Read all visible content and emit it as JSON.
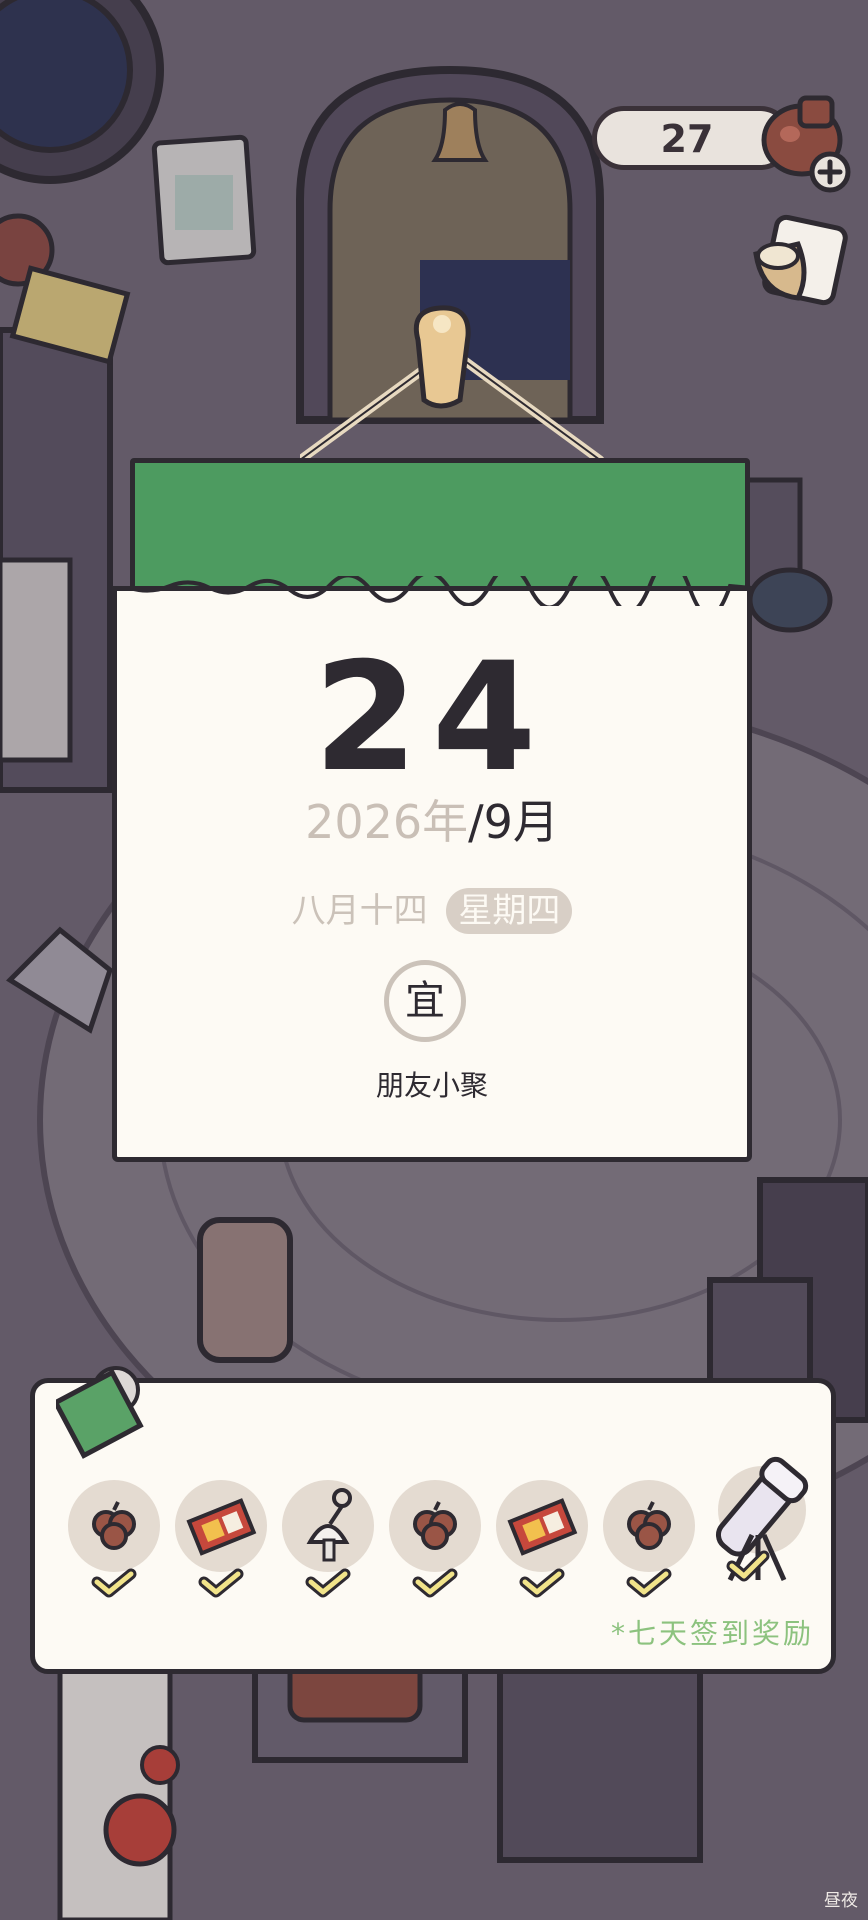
{
  "hud": {
    "coin_count": "27",
    "coin_icon": "clover-bag-icon",
    "add_icon": "plus-icon",
    "cup_icon": "bowl-icon"
  },
  "calendar": {
    "day": "24",
    "year": "2026年",
    "month": "/9月",
    "lunar_date": "八月十四",
    "weekday": "星期四",
    "suitable_label": "宜",
    "activity": "朋友小聚"
  },
  "rewards": {
    "items": [
      {
        "icon": "clover-icon",
        "claimed": true
      },
      {
        "icon": "ticket-icon",
        "claimed": true
      },
      {
        "icon": "wind-chime-icon",
        "claimed": true
      },
      {
        "icon": "clover-icon",
        "claimed": true
      },
      {
        "icon": "ticket-icon",
        "claimed": true
      },
      {
        "icon": "clover-icon",
        "claimed": true
      },
      {
        "icon": "telescope-icon",
        "claimed": true
      }
    ],
    "note": "*七天签到奖励"
  },
  "mode_label": "昼夜",
  "colors": {
    "calendar_green": "#4d9b60",
    "paper": "#fdfaf4",
    "outline": "#2e2a31",
    "note_green": "#8cc27e",
    "background": "#6b6270"
  }
}
